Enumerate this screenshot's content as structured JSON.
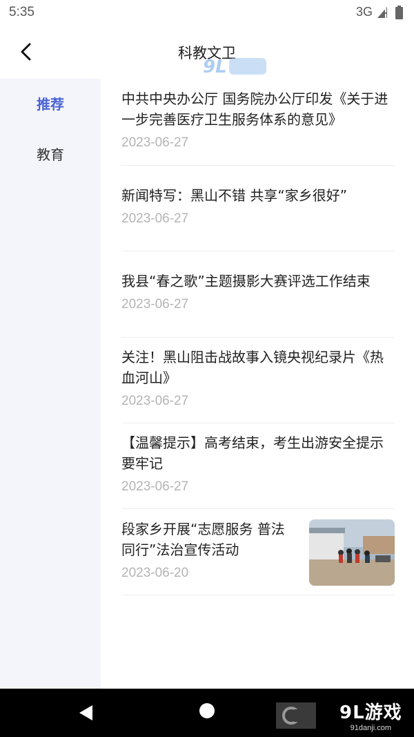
{
  "status_bar": {
    "time": "5:35",
    "network": "3G",
    "icons": [
      "signal-icon",
      "battery-icon"
    ]
  },
  "header": {
    "title": "科教文卫",
    "back_icon": "chevron-left-icon",
    "watermark": "91游戏"
  },
  "sidebar": {
    "items": [
      {
        "label": "推荐",
        "active": true
      },
      {
        "label": "教育",
        "active": false
      }
    ],
    "accent_color": "#4a63d6"
  },
  "articles": [
    {
      "title": "中共中央办公厅 国务院办公厅印发《关于进一步完善医疗卫生服务体系的意见》",
      "date": "2023-06-27"
    },
    {
      "title": "新闻特写：黑山不错 共享“家乡很好”",
      "date": "2023-06-27"
    },
    {
      "title": "我县“春之歌”主题摄影大赛评选工作结束",
      "date": "2023-06-27"
    },
    {
      "title": "关注！黑山阻击战故事入镜央视纪录片《热血河山》",
      "date": "2023-06-27"
    },
    {
      "title": "【温馨提示】高考结束，考生出游安全提示要牢记",
      "date": "2023-06-27"
    },
    {
      "title": "段家乡开展“志愿服务 普法同行”法治宣传活动",
      "date": "2023-06-20",
      "has_thumbnail": true
    }
  ],
  "nav_bar": {
    "icons": [
      "back-triangle-icon",
      "home-circle-icon"
    ],
    "watermark_brand": "9L游戏",
    "watermark_domain": "91danji.com"
  }
}
